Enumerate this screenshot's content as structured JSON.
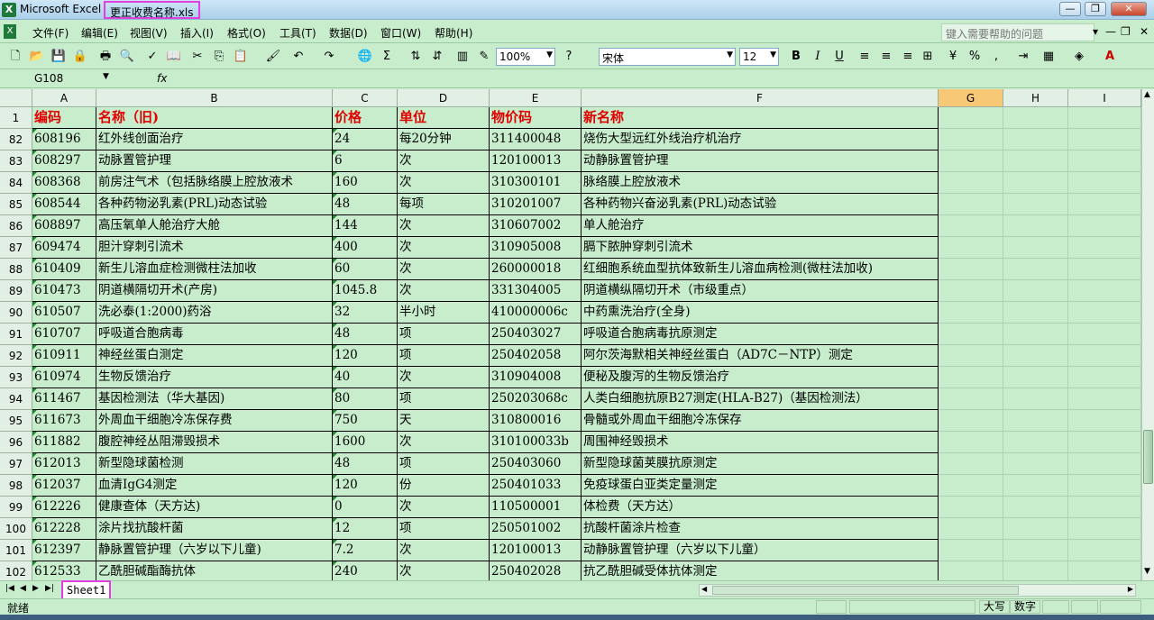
{
  "window": {
    "app_title": "Microsoft Excel",
    "file_title": "更正收费名称.xls",
    "minimize": "—",
    "restore": "❐",
    "close": "✕"
  },
  "menu": {
    "items": [
      "文件(F)",
      "编辑(E)",
      "视图(V)",
      "插入(I)",
      "格式(O)",
      "工具(T)",
      "数据(D)",
      "窗口(W)",
      "帮助(H)"
    ],
    "help_placeholder": "键入需要帮助的问题"
  },
  "toolbar": {
    "zoom": "100%",
    "font": "宋体",
    "font_size": "12",
    "bold": "B",
    "italic": "I",
    "underline": "U"
  },
  "formula": {
    "cell_ref": "G108",
    "fx": "fx"
  },
  "columns": [
    "A",
    "B",
    "C",
    "D",
    "E",
    "F",
    "G",
    "H",
    "I"
  ],
  "header_row": {
    "row": "1",
    "cells": [
      "编码",
      "名称（旧)",
      "价格",
      "单位",
      "物价码",
      "新名称"
    ]
  },
  "rows": [
    {
      "row": "82",
      "cells": [
        "608196",
        "红外线创面治疗",
        "24",
        "每20分钟",
        "311400048",
        "烧伤大型远红外线治疗机治疗"
      ]
    },
    {
      "row": "83",
      "cells": [
        "608297",
        "动脉置管护理",
        "6",
        "次",
        "120100013",
        "动静脉置管护理"
      ]
    },
    {
      "row": "84",
      "cells": [
        "608368",
        "前房注气术（包括脉络膜上腔放液术",
        "160",
        "次",
        "310300101",
        "脉络膜上腔放液术"
      ]
    },
    {
      "row": "85",
      "cells": [
        "608544",
        "各种药物泌乳素(PRL)动态试验",
        "48",
        "每项",
        "310201007",
        "各种药物兴奋泌乳素(PRL)动态试验"
      ]
    },
    {
      "row": "86",
      "cells": [
        "608897",
        "高压氧单人舱治疗大舱",
        "144",
        "次",
        "310607002",
        "单人舱治疗"
      ]
    },
    {
      "row": "87",
      "cells": [
        "609474",
        "胆汁穿刺引流术",
        "400",
        "次",
        "310905008",
        "膈下脓肿穿刺引流术"
      ]
    },
    {
      "row": "88",
      "cells": [
        "610409",
        "新生儿溶血症检测微柱法加收",
        "60",
        "次",
        "260000018",
        "红细胞系统血型抗体致新生儿溶血病检测(微柱法加收)"
      ]
    },
    {
      "row": "89",
      "cells": [
        "610473",
        "阴道横隔切开术(产房)",
        "1045.8",
        "次",
        "331304005",
        "阴道横纵隔切开术（市级重点）"
      ]
    },
    {
      "row": "90",
      "cells": [
        "610507",
        "洗必泰(1:2000)药浴",
        "32",
        "半小时",
        "410000006c",
        "中药熏洗治疗(全身)"
      ]
    },
    {
      "row": "91",
      "cells": [
        "610707",
        "呼吸道合胞病毒",
        "48",
        "项",
        "250403027",
        "呼吸道合胞病毒抗原测定"
      ]
    },
    {
      "row": "92",
      "cells": [
        "610911",
        "神经丝蛋白测定",
        "120",
        "项",
        "250402058",
        "阿尔茨海默相关神经丝蛋白（AD7C－NTP）测定"
      ]
    },
    {
      "row": "93",
      "cells": [
        "610974",
        "生物反馈治疗",
        "40",
        "次",
        "310904008",
        "便秘及腹泻的生物反馈治疗"
      ]
    },
    {
      "row": "94",
      "cells": [
        "611467",
        "基因检测法（华大基因)",
        "80",
        "项",
        "250203068c",
        "人类白细胞抗原B27测定(HLA-B27)（基因检测法）"
      ]
    },
    {
      "row": "95",
      "cells": [
        "611673",
        "外周血干细胞冷冻保存费",
        "750",
        "天",
        "310800016",
        "骨髓或外周血干细胞冷冻保存"
      ]
    },
    {
      "row": "96",
      "cells": [
        "611882",
        "腹腔神经丛阻滞毁损术",
        "1600",
        "次",
        "310100033b",
        "周围神经毁损术"
      ]
    },
    {
      "row": "97",
      "cells": [
        "612013",
        "新型隐球菌检测",
        "48",
        "项",
        "250403060",
        "新型隐球菌荚膜抗原测定"
      ]
    },
    {
      "row": "98",
      "cells": [
        "612037",
        "血清IgG4测定",
        "120",
        "份",
        "250401033",
        "免疫球蛋白亚类定量测定"
      ]
    },
    {
      "row": "99",
      "cells": [
        "612226",
        "健康查体（天方达)",
        "0",
        "次",
        "110500001",
        "体检费（天方达）"
      ]
    },
    {
      "row": "100",
      "cells": [
        "612228",
        "涂片找抗酸杆菌",
        "12",
        "项",
        "250501002",
        "抗酸杆菌涂片检查"
      ]
    },
    {
      "row": "101",
      "cells": [
        "612397",
        "静脉置管护理（六岁以下儿童)",
        "7.2",
        "次",
        "120100013",
        "动静脉置管护理（六岁以下儿童）"
      ]
    },
    {
      "row": "102",
      "cells": [
        "612533",
        "乙酰胆碱酯酶抗体",
        "240",
        "次",
        "250402028",
        "抗乙酰胆碱受体抗体测定"
      ]
    }
  ],
  "sheet_tab": "Sheet1",
  "status": {
    "ready": "就绪",
    "caps": "大写",
    "num": "数字"
  },
  "colors": {
    "sheet_bg": "#c7edcc",
    "header_text": "#e00000",
    "highlight": "#e040e0"
  }
}
